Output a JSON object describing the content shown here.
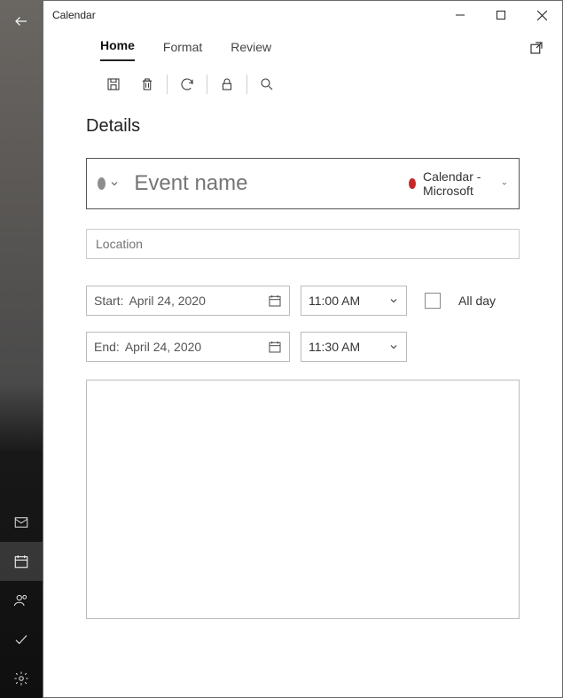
{
  "titlebar": {
    "title": "Calendar"
  },
  "tabs": {
    "home": "Home",
    "format": "Format",
    "review": "Review"
  },
  "section": {
    "details": "Details"
  },
  "event": {
    "name_placeholder": "Event name",
    "calendar_label": "Calendar - Microsoft"
  },
  "location": {
    "placeholder": "Location"
  },
  "start": {
    "label": "Start:",
    "date": "April 24, 2020",
    "time": "11:00 AM"
  },
  "end": {
    "label": "End:",
    "date": "April 24, 2020",
    "time": "11:30 AM"
  },
  "allday": {
    "label": "All day"
  }
}
